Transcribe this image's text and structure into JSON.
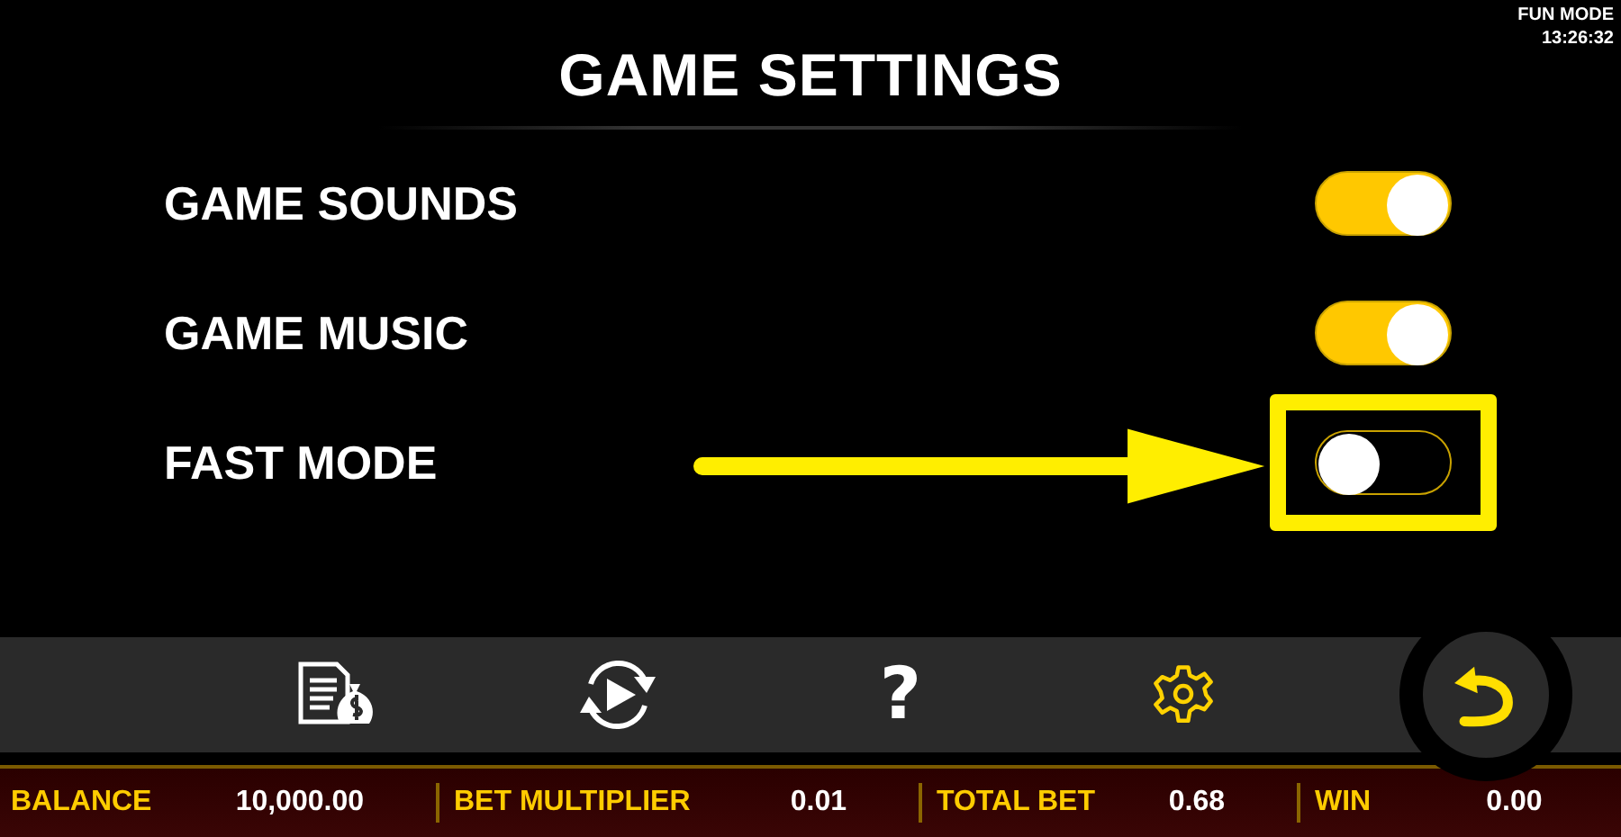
{
  "header": {
    "mode": "FUN MODE",
    "time": "13:26:32"
  },
  "title": "GAME SETTINGS",
  "settings": [
    {
      "label": "GAME SOUNDS",
      "on": true,
      "highlighted": false
    },
    {
      "label": "GAME MUSIC",
      "on": true,
      "highlighted": false
    },
    {
      "label": "FAST MODE",
      "on": false,
      "highlighted": true
    }
  ],
  "toolbar": [
    {
      "kind": "paytable",
      "selected": false
    },
    {
      "kind": "autoplay",
      "selected": false
    },
    {
      "kind": "help",
      "label": "?",
      "selected": false
    },
    {
      "kind": "settings",
      "selected": true
    }
  ],
  "status_bar": [
    {
      "label": "BALANCE",
      "value": "10,000.00"
    },
    {
      "label": "BET MULTIPLIER",
      "value": "0.01"
    },
    {
      "label": "TOTAL BET",
      "value": "0.68"
    },
    {
      "label": "WIN",
      "value": "0.00"
    }
  ]
}
